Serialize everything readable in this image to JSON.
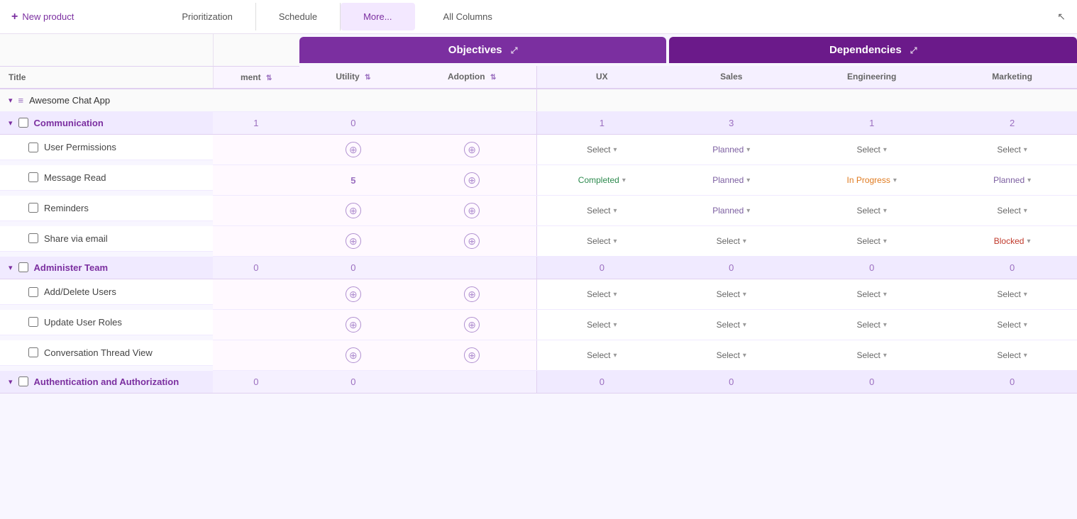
{
  "topbar": {
    "new_product_label": "New product",
    "tabs": [
      {
        "label": "Prioritization",
        "active": false
      },
      {
        "label": "Schedule",
        "active": false
      },
      {
        "label": "More...",
        "active": true
      },
      {
        "label": "All Columns",
        "active": false
      }
    ]
  },
  "sections": {
    "objectives": {
      "label": "Objectives",
      "expand_icon": "⤢",
      "columns": [
        {
          "label": "ment",
          "filterable": true
        },
        {
          "label": "Utility",
          "filterable": true
        },
        {
          "label": "Adoption",
          "filterable": true
        }
      ]
    },
    "dependencies": {
      "label": "Dependencies",
      "expand_icon": "⤢",
      "columns": [
        {
          "label": "UX",
          "filterable": false
        },
        {
          "label": "Sales",
          "filterable": false
        },
        {
          "label": "Engineering",
          "filterable": false
        },
        {
          "label": "Marketing",
          "filterable": false
        }
      ]
    }
  },
  "title_column": "Title",
  "app": {
    "name": "Awesome Chat App"
  },
  "groups": [
    {
      "name": "Communication",
      "obj_col1": "1",
      "obj_col2": "0",
      "dep_ux": "1",
      "dep_sales": "3",
      "dep_eng": "1",
      "dep_mkt": "2",
      "items": [
        {
          "name": "User Permissions",
          "obj_col1": "+",
          "obj_col2": "+",
          "dep_ux": "Select",
          "dep_sales": "Planned",
          "dep_eng": "Select",
          "dep_mkt": "Select",
          "dep_ux_status": "select",
          "dep_sales_status": "planned",
          "dep_eng_status": "select",
          "dep_mkt_status": "select"
        },
        {
          "name": "Message Read",
          "obj_col1": "5",
          "obj_col2": "+",
          "dep_ux": "Completed",
          "dep_sales": "Planned",
          "dep_eng": "In Progress",
          "dep_mkt": "Planned",
          "dep_ux_status": "completed",
          "dep_sales_status": "planned",
          "dep_eng_status": "inprogress",
          "dep_mkt_status": "planned"
        },
        {
          "name": "Reminders",
          "obj_col1": "+",
          "obj_col2": "+",
          "dep_ux": "Select",
          "dep_sales": "Planned",
          "dep_eng": "Select",
          "dep_mkt": "Select",
          "dep_ux_status": "select",
          "dep_sales_status": "planned",
          "dep_eng_status": "select",
          "dep_mkt_status": "select"
        },
        {
          "name": "Share via email",
          "obj_col1": "+",
          "obj_col2": "+",
          "dep_ux": "Select",
          "dep_sales": "Select",
          "dep_eng": "Select",
          "dep_mkt": "Blocked",
          "dep_ux_status": "select",
          "dep_sales_status": "select",
          "dep_eng_status": "select",
          "dep_mkt_status": "blocked"
        }
      ]
    },
    {
      "name": "Administer Team",
      "obj_col1": "0",
      "obj_col2": "0",
      "dep_ux": "0",
      "dep_sales": "0",
      "dep_eng": "0",
      "dep_mkt": "0",
      "items": [
        {
          "name": "Add/Delete Users",
          "obj_col1": "+",
          "obj_col2": "+",
          "dep_ux": "Select",
          "dep_sales": "Select",
          "dep_eng": "Select",
          "dep_mkt": "Select",
          "dep_ux_status": "select",
          "dep_sales_status": "select",
          "dep_eng_status": "select",
          "dep_mkt_status": "select"
        },
        {
          "name": "Update User Roles",
          "obj_col1": "+",
          "obj_col2": "+",
          "dep_ux": "Select",
          "dep_sales": "Select",
          "dep_eng": "Select",
          "dep_mkt": "Select",
          "dep_ux_status": "select",
          "dep_sales_status": "select",
          "dep_eng_status": "select",
          "dep_mkt_status": "select"
        },
        {
          "name": "Conversation Thread View",
          "obj_col1": "+",
          "obj_col2": "+",
          "dep_ux": "Select",
          "dep_sales": "Select",
          "dep_eng": "Select",
          "dep_mkt": "Select",
          "dep_ux_status": "select",
          "dep_sales_status": "select",
          "dep_eng_status": "select",
          "dep_mkt_status": "select"
        }
      ]
    },
    {
      "name": "Authentication and Authorization",
      "obj_col1": "0",
      "obj_col2": "0",
      "dep_ux": "0",
      "dep_sales": "0",
      "dep_eng": "0",
      "dep_mkt": "0",
      "items": []
    }
  ],
  "icons": {
    "plus_circle": "⊕",
    "chevron_down": "▾",
    "chevron_right": "▸",
    "expand": "⤢",
    "menu": "≡",
    "cursor": "↖",
    "filter": "⇅"
  },
  "colors": {
    "objectives_bg": "#7b2fa0",
    "dependencies_bg": "#6b1a8a",
    "accent": "#7b2fa0"
  }
}
